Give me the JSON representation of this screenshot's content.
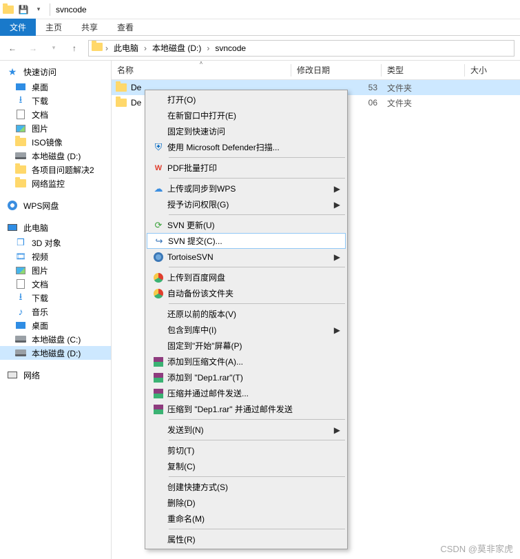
{
  "window": {
    "title": "svncode"
  },
  "ribbon": {
    "file": "文件",
    "tabs": [
      "主页",
      "共享",
      "查看"
    ]
  },
  "breadcrumb": {
    "items": [
      "此电脑",
      "本地磁盘 (D:)",
      "svncode"
    ]
  },
  "columns": {
    "name": "名称",
    "modified": "修改日期",
    "type": "类型",
    "size": "大小"
  },
  "rows": [
    {
      "name": "De",
      "date_tail": "53",
      "type": "文件夹",
      "selected": true
    },
    {
      "name": "De",
      "date_tail": "06",
      "type": "文件夹",
      "selected": false
    }
  ],
  "sidebar": {
    "quick": {
      "title": "快速访问",
      "items": [
        "桌面",
        "下载",
        "文档",
        "图片",
        "ISO镜像",
        "本地磁盘 (D:)",
        "各项目问题解决2",
        "网络监控"
      ]
    },
    "wps": "WPS网盘",
    "pc": {
      "title": "此电脑",
      "items": [
        "3D 对象",
        "视频",
        "图片",
        "文档",
        "下载",
        "音乐",
        "桌面",
        "本地磁盘 (C:)",
        "本地磁盘 (D:)"
      ]
    },
    "network": "网络"
  },
  "context_menu": {
    "sections": [
      [
        {
          "label": "打开(O)",
          "icon": ""
        },
        {
          "label": "在新窗口中打开(E)",
          "icon": ""
        },
        {
          "label": "固定到快速访问",
          "icon": ""
        },
        {
          "label": "使用 Microsoft Defender扫描...",
          "icon": "shield"
        }
      ],
      [
        {
          "label": "PDF批量打印",
          "icon": "wpspdf"
        }
      ],
      [
        {
          "label": "上传或同步到WPS",
          "icon": "cloud",
          "sub": true
        },
        {
          "label": "授予访问权限(G)",
          "icon": "",
          "sub": true
        }
      ],
      [
        {
          "label": "SVN 更新(U)",
          "icon": "svn-green"
        },
        {
          "label": "SVN 提交(C)...",
          "icon": "svn-blue",
          "hl": true
        },
        {
          "label": "TortoiseSVN",
          "icon": "tort",
          "sub": true
        }
      ],
      [
        {
          "label": "上传到百度网盘",
          "icon": "bdisk"
        },
        {
          "label": "自动备份该文件夹",
          "icon": "bdisk"
        }
      ],
      [
        {
          "label": "还原以前的版本(V)",
          "icon": ""
        },
        {
          "label": "包含到库中(I)",
          "icon": "",
          "sub": true
        },
        {
          "label": "固定到\"开始\"屏幕(P)",
          "icon": ""
        },
        {
          "label": "添加到压缩文件(A)...",
          "icon": "rar"
        },
        {
          "label": "添加到 \"Dep1.rar\"(T)",
          "icon": "rar"
        },
        {
          "label": "压缩并通过邮件发送...",
          "icon": "rar"
        },
        {
          "label": "压缩到 \"Dep1.rar\" 并通过邮件发送",
          "icon": "rar"
        }
      ],
      [
        {
          "label": "发送到(N)",
          "icon": "",
          "sub": true
        }
      ],
      [
        {
          "label": "剪切(T)",
          "icon": ""
        },
        {
          "label": "复制(C)",
          "icon": ""
        }
      ],
      [
        {
          "label": "创建快捷方式(S)",
          "icon": ""
        },
        {
          "label": "删除(D)",
          "icon": ""
        },
        {
          "label": "重命名(M)",
          "icon": ""
        }
      ],
      [
        {
          "label": "属性(R)",
          "icon": ""
        }
      ]
    ]
  },
  "watermark": "CSDN @莫非家虎"
}
